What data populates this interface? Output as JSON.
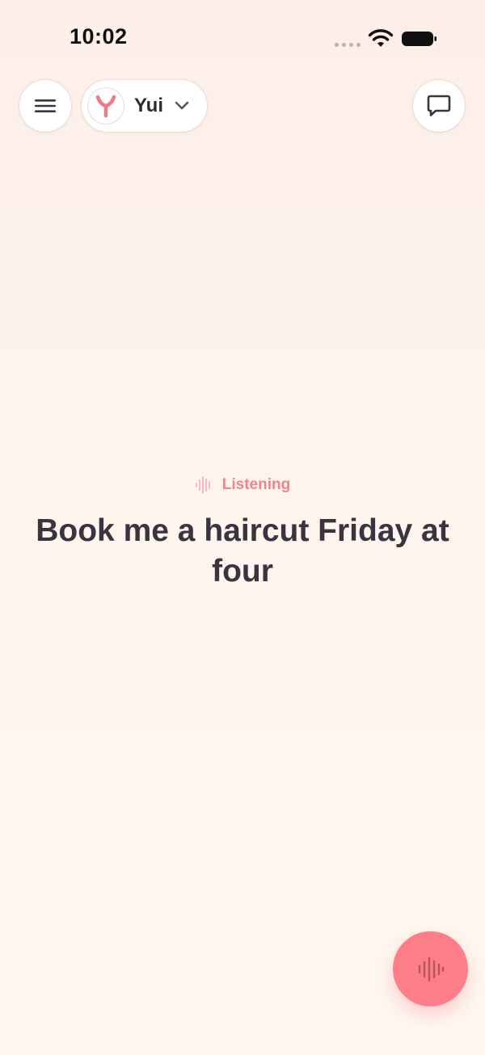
{
  "status_bar": {
    "time": "10:02",
    "signal_icon": "signal-dots-icon",
    "wifi_icon": "wifi-icon",
    "battery_icon": "battery-icon"
  },
  "header": {
    "menu_icon": "hamburger-menu-icon",
    "persona": {
      "name": "Yui",
      "avatar_icon": "y-logo-icon",
      "dropdown_icon": "chevron-down-icon"
    },
    "chat_icon": "chat-bubble-icon"
  },
  "main": {
    "status_label": "Listening",
    "status_icon": "sound-wave-icon",
    "transcript": "Book me a haircut Friday at four"
  },
  "voice_button": {
    "icon": "sound-wave-icon"
  },
  "colors": {
    "accent": "#fd7e88",
    "listening_text": "#f0848e",
    "text_primary": "#3a3340",
    "background_top": "#fdeee8",
    "background_bottom": "#fef8f1"
  }
}
